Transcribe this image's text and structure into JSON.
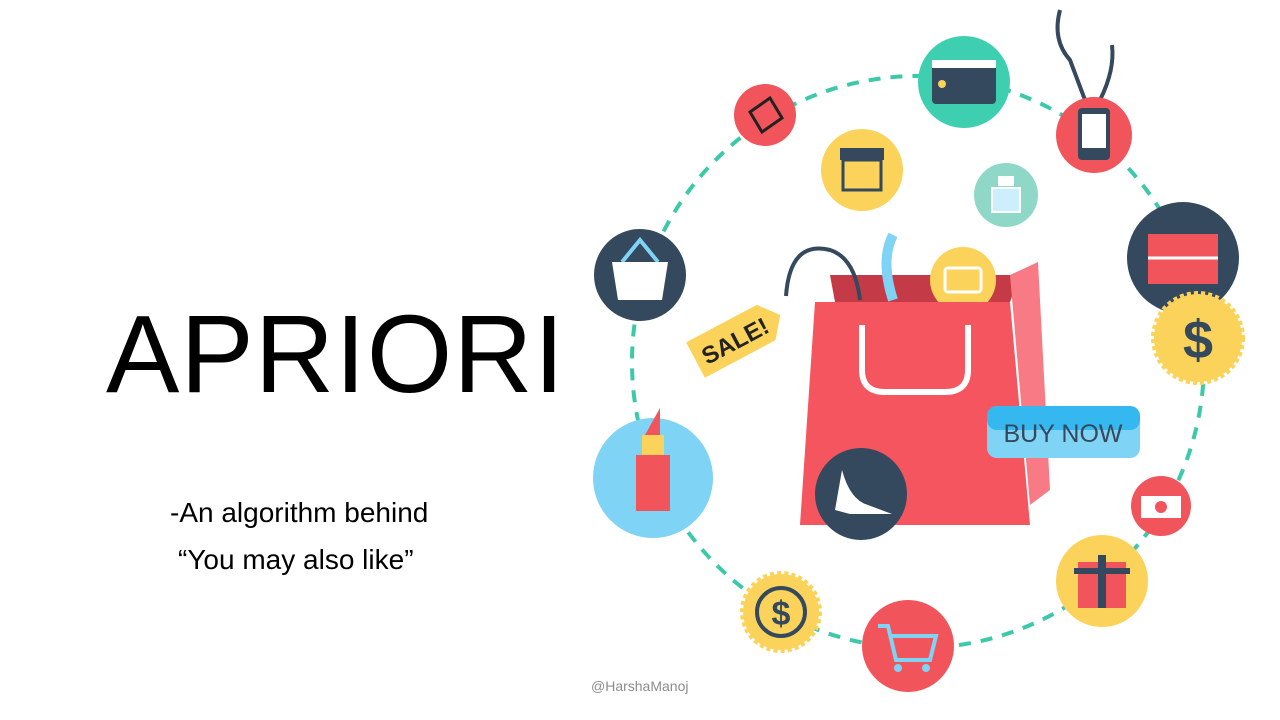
{
  "slide": {
    "title": "APRIORI",
    "subtitle_line1": "-An algorithm behind",
    "subtitle_line2": "“You may also like”",
    "credit": "@HarshaManoj"
  },
  "illustration": {
    "sale_tag": "SALE!",
    "buy_button": "BUY NOW",
    "colors": {
      "ring": "#3cc9a9",
      "bag": "#f4555f",
      "yellow": "#fbd35a",
      "dark": "#34495e",
      "light_blue": "#7fd3f4",
      "teal": "#3dcfb0"
    }
  }
}
